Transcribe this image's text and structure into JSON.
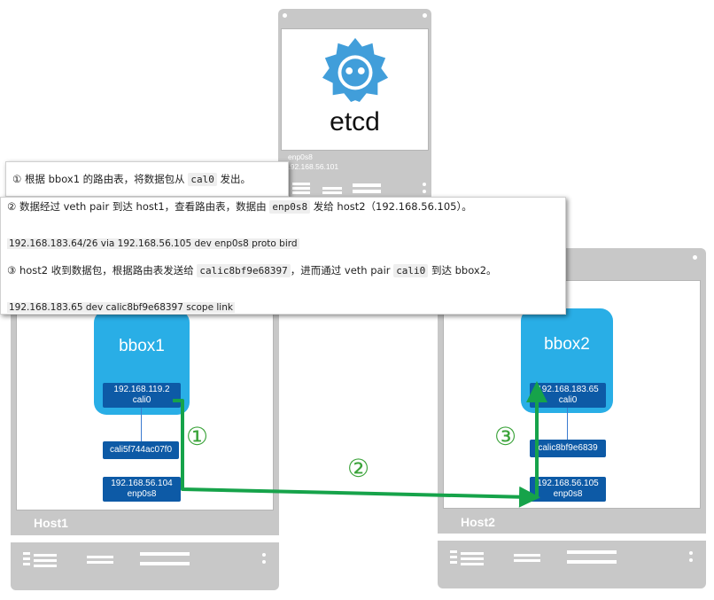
{
  "etcd": {
    "name": "etcd",
    "interface": "enp0s8",
    "ip": "192.168.56.101"
  },
  "host1": {
    "name": "Host1",
    "container": "bbox1",
    "container_ip": "192.168.119.2",
    "container_if": "cali0",
    "veth": "cali5f744ac07f0",
    "nic_ip": "192.168.56.104",
    "nic_if": "enp0s8"
  },
  "host2": {
    "name": "Host2",
    "container": "bbox2",
    "container_ip": "192.168.183.65",
    "container_if": "cali0",
    "veth": "calic8bf9e6839",
    "nic_ip": "192.168.56.105",
    "nic_if": "enp0s8"
  },
  "steps": {
    "s1": {
      "num": "①",
      "text_a": "① 根据 bbox1 的路由表，将数据包从 ",
      "code": "cal0",
      "text_b": " 发出。"
    },
    "s2": {
      "num": "②",
      "text_a": "② 数据经过 veth pair 到达 host1，查看路由表，数据由 ",
      "code": "enp0s8",
      "text_b": " 发给 host2（192.168.56.105）。",
      "route": "192.168.183.64/26 via 192.168.56.105 dev enp0s8  proto bird"
    },
    "s3": {
      "num": "③",
      "text_a": "③ host2 收到数据包，根据路由表发送给 ",
      "code": "calic8bf9e68397",
      "text_b": "，进而通过 veth pair ",
      "code2": "cali0",
      "text_c": " 到达 bbox2。",
      "route": "192.168.183.65 dev calic8bf9e68397  scope link"
    }
  },
  "colors": {
    "arrow": "#16a34a",
    "step_number": "#3ba33a",
    "container": "#29aee6",
    "interface": "#0d5aa6",
    "server": "#c8c8c8",
    "etcd_logo": "#419eda"
  }
}
